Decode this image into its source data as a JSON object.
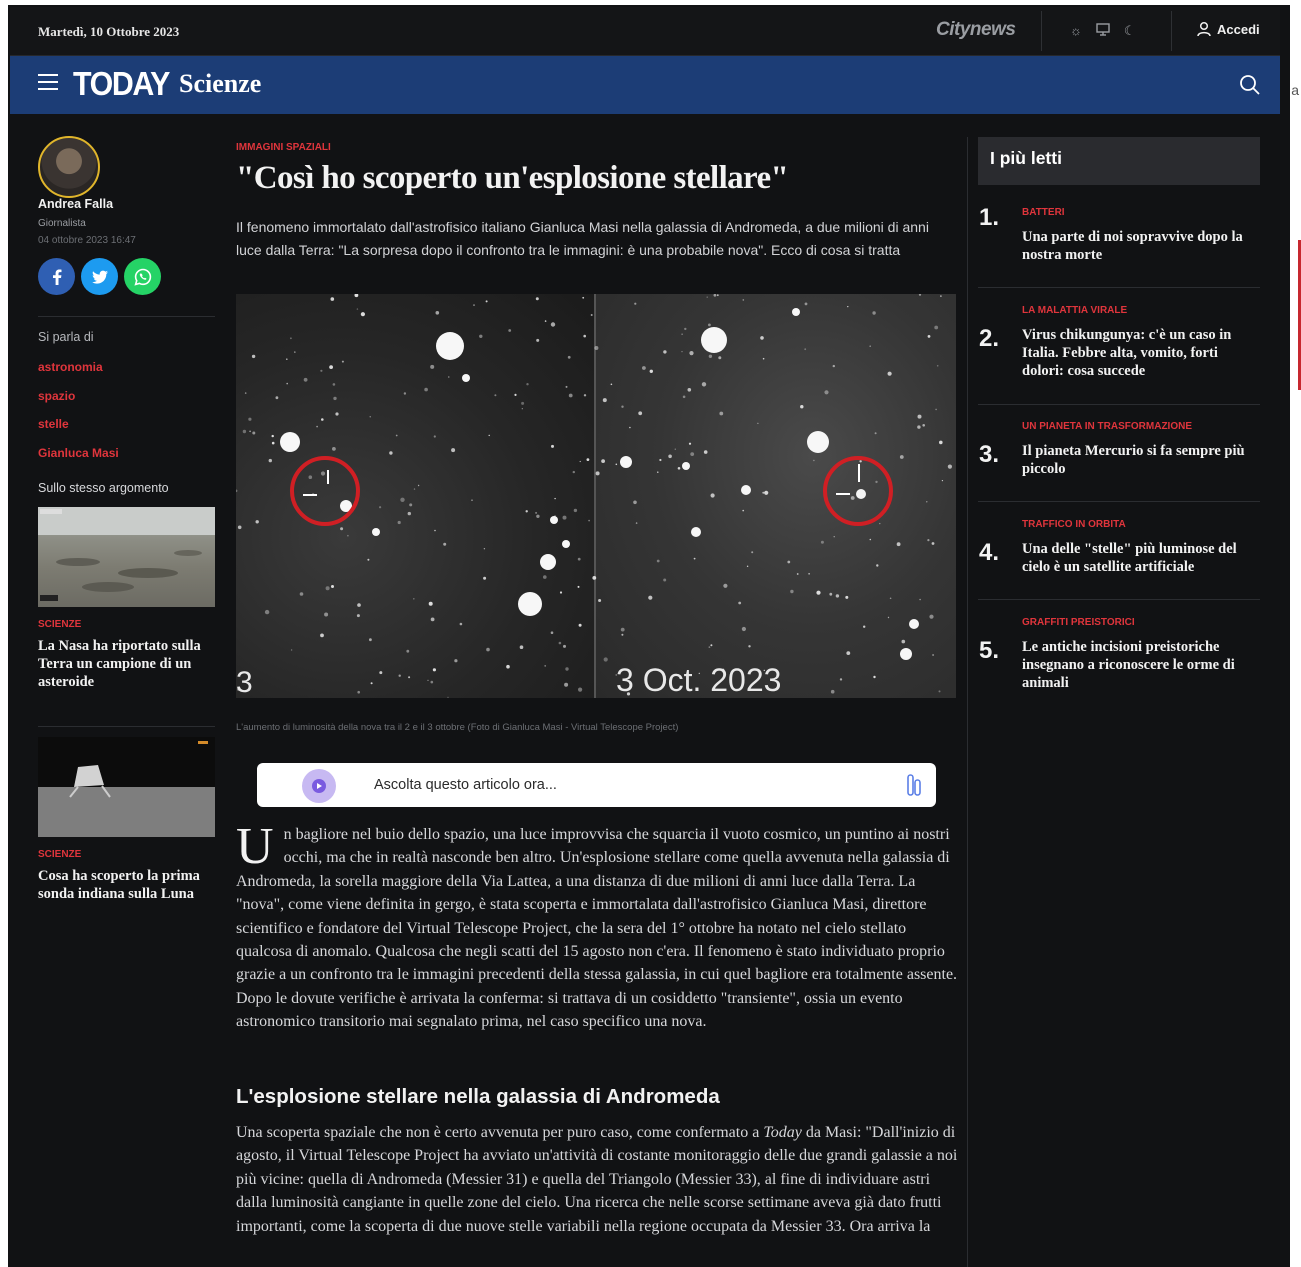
{
  "topbar": {
    "date": "Martedì, 10 Ottobre 2023",
    "network": "Citynews",
    "login_label": "Accedi"
  },
  "brand": {
    "logo": "TODAY",
    "section": "Scienze",
    "accent_color": "#1c3d76",
    "tag_color": "#e0353c"
  },
  "author": {
    "name": "Andrea Falla",
    "role": "Giornalista",
    "date": "04 ottobre 2023 16:47"
  },
  "topics": {
    "title": "Si parla di",
    "tags": [
      "astronomia",
      "spazio",
      "stelle",
      "Gianluca Masi"
    ]
  },
  "related": {
    "title": "Sullo stesso argomento",
    "items": [
      {
        "category": "SCIENZE",
        "headline": "La Nasa ha riportato sulla Terra un campione di un asteroide"
      },
      {
        "category": "SCIENZE",
        "headline": "Cosa ha scoperto la prima sonda indiana sulla Luna"
      }
    ]
  },
  "article": {
    "kicker": "IMMAGINI SPAZIALI",
    "headline": "\"Così ho scoperto un'esplosione stellare\"",
    "subtitle": "Il fenomeno immortalato dall'astrofisico italiano Gianluca Masi nella galassia di Andromeda, a due milioni di anni luce dalla Terra: \"La sorpresa dopo il confronto tra le immagini: è una probabile nova\". Ecco di cosa si tratta",
    "image_left_label": "3",
    "image_right_label": "3 Oct. 2023",
    "caption": "L'aumento di luminosità della nova tra il 2 e il 3 ottobre (Foto di Gianluca Masi - Virtual Telescope Project)",
    "audio_label": "Ascolta questo articolo ora...",
    "dropcap": "U",
    "paragraph1": "n bagliore nel buio dello spazio, una luce improvvisa che squarcia il vuoto cosmico, un puntino ai nostri occhi, ma che in realtà nasconde ben altro. Un'esplosione stellare come quella avvenuta nella galassia di Andromeda, la sorella maggiore della Via Lattea, a una distanza di due milioni di anni luce dalla Terra. La \"nova\", come viene definita in gergo, è stata scoperta e immortalata dall'astrofisico Gianluca Masi, direttore scientifico e fondatore del Virtual Telescope Project, che la sera del 1° ottobre ha notato nel cielo stellato qualcosa di anomalo. Qualcosa che negli scatti del 15 agosto non c'era. Il fenomeno è stato individuato proprio grazie a un confronto tra le immagini precedenti della stessa galassia, in cui quel bagliore era totalmente assente. Dopo le dovute verifiche è arrivata la conferma: si trattava di un cosiddetto \"transiente\", ossia un evento astronomico transitorio mai segnalato prima, nel caso specifico una nova.",
    "subheading": "L'esplosione stellare nella galassia di Andromeda",
    "paragraph2_a": "Una scoperta spaziale che non è certo avvenuta per puro caso, come confermato a ",
    "paragraph2_em": "Today",
    "paragraph2_b": " da Masi: \"Dall'inizio di agosto, il Virtual Telescope Project ha avviato un'attività di costante monitoraggio delle due grandi galassie a noi più vicine: quella di Andromeda (Messier 31) e quella del Triangolo (Messier 33), al fine di individuare astri dalla luminosità cangiante in quelle zone del cielo. Una ricerca che nelle scorse settimane aveva già dato frutti importanti, come la scoperta di due nuove stelle variabili nella regione occupata da Messier 33. Ora arriva la"
  },
  "most_read": {
    "title": "I più letti",
    "items": [
      {
        "rank": "1.",
        "category": "BATTERI",
        "headline": "Una parte di noi sopravvive dopo la nostra morte"
      },
      {
        "rank": "2.",
        "category": "LA MALATTIA VIRALE",
        "headline": "Virus chikungunya: c'è un caso in Italia. Febbre alta, vomito, forti dolori: cosa succede"
      },
      {
        "rank": "3.",
        "category": "UN PIANETA IN TRASFORMAZIONE",
        "headline": "Il pianeta Mercurio si fa sempre più piccolo"
      },
      {
        "rank": "4.",
        "category": "TRAFFICO IN ORBITA",
        "headline": "Una delle \"stelle\" più luminose del cielo è un satellite artificiale"
      },
      {
        "rank": "5.",
        "category": "GRAFFITI PREISTORICI",
        "headline": "Le antiche incisioni preistoriche insegnano a riconoscere le orme di animali"
      }
    ]
  },
  "edge_peek": "a"
}
